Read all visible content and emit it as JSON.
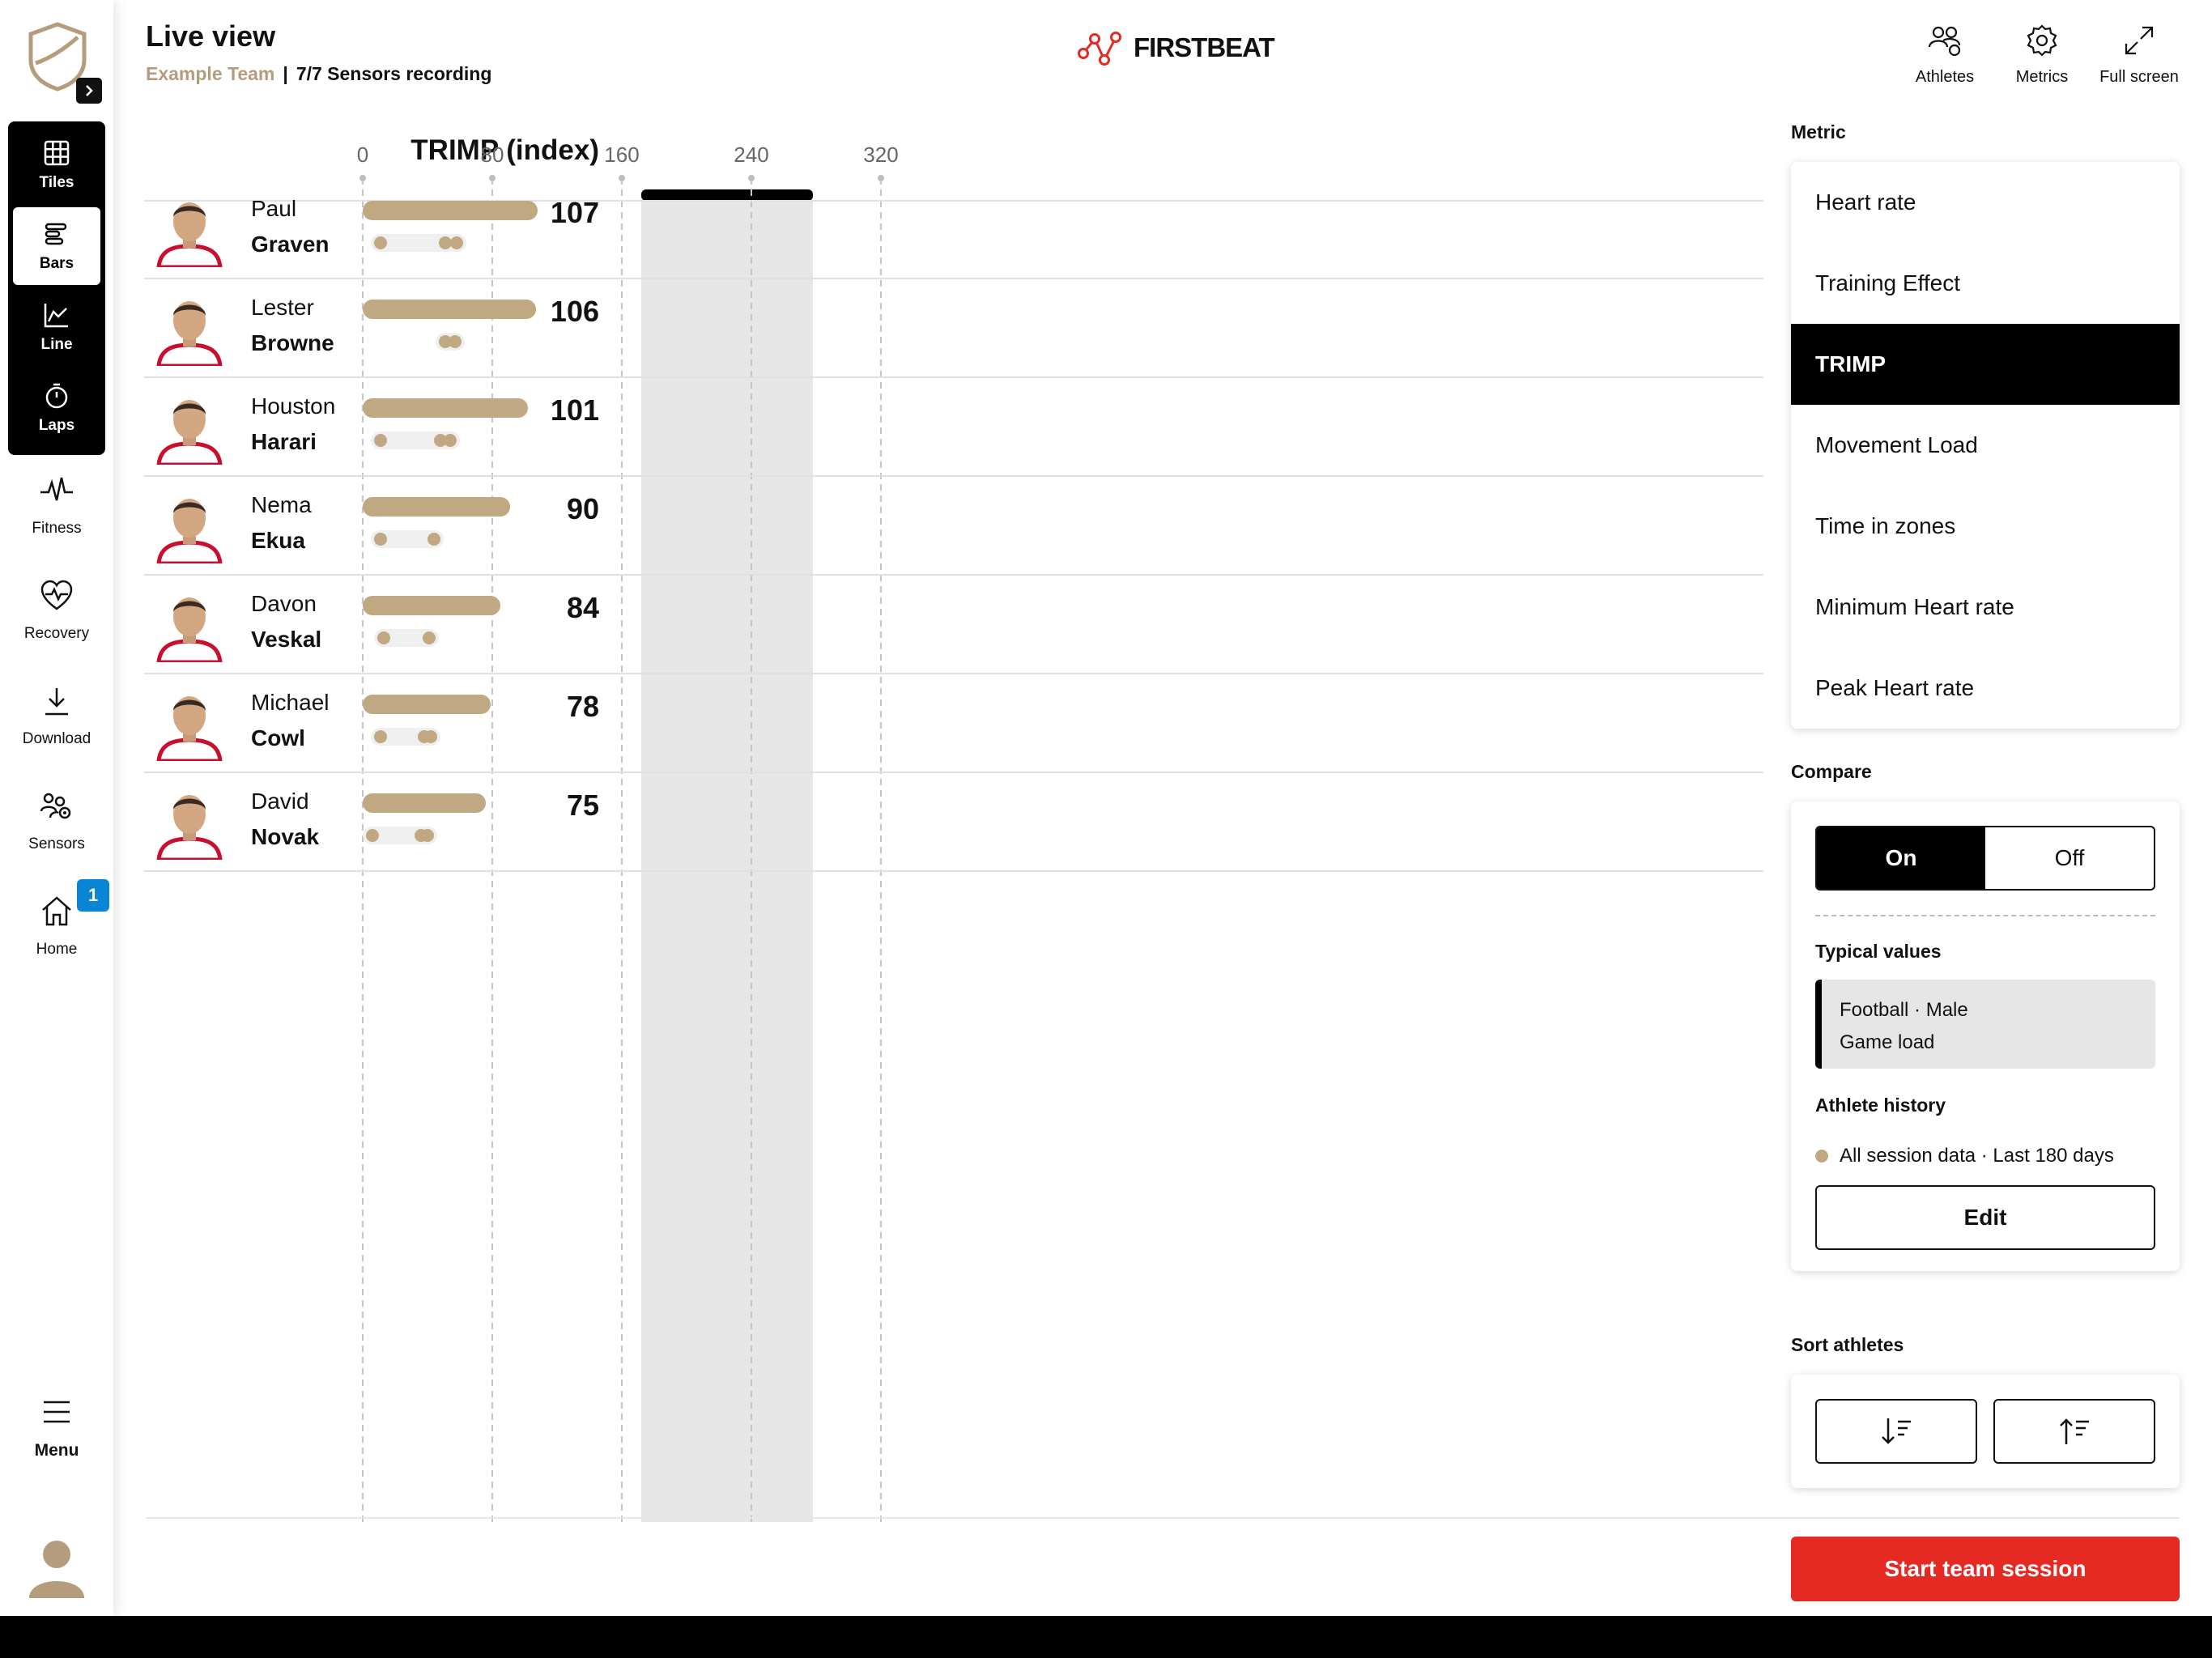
{
  "header": {
    "title": "Live view",
    "team": "Example Team",
    "separator": "|",
    "status": "7/7 Sensors recording",
    "brand": "FIRSTBEAT",
    "actions": [
      {
        "label": "Athletes",
        "icon": "athletes-icon"
      },
      {
        "label": "Metrics",
        "icon": "gear-icon"
      },
      {
        "label": "Full screen",
        "icon": "fullscreen-icon"
      }
    ]
  },
  "nav": {
    "views": [
      {
        "label": "Tiles",
        "icon": "grid-icon"
      },
      {
        "label": "Bars",
        "icon": "bars-icon",
        "active": true
      },
      {
        "label": "Line",
        "icon": "line-chart-icon"
      },
      {
        "label": "Laps",
        "icon": "stopwatch-icon"
      }
    ],
    "items": [
      {
        "label": "Fitness",
        "icon": "heartbeat-icon"
      },
      {
        "label": "Recovery",
        "icon": "heart-pulse-icon"
      },
      {
        "label": "Download",
        "icon": "download-icon"
      },
      {
        "label": "Sensors",
        "icon": "sensors-icon"
      },
      {
        "label": "Home",
        "icon": "home-icon"
      }
    ],
    "home_badge": "1",
    "menu_label": "Menu"
  },
  "chart_data": {
    "type": "bar",
    "title": "TRIMP (index)",
    "x_ticks": [
      "0",
      "80",
      "160",
      "240",
      "320"
    ],
    "xlim": [
      0,
      400
    ],
    "reference_range": [
      172,
      278
    ],
    "colors": {
      "bar": "#c0a882",
      "history_track": "#efefef",
      "reference": "#e6e6e6"
    },
    "athletes": [
      {
        "first": "Paul",
        "last": "Graven",
        "value": 107,
        "history": [
          11,
          51,
          58
        ]
      },
      {
        "first": "Lester",
        "last": "Browne",
        "value": 106,
        "history": [
          51,
          57
        ]
      },
      {
        "first": "Houston",
        "last": "Harari",
        "value": 101,
        "history": [
          11,
          48,
          54
        ]
      },
      {
        "first": "Nema",
        "last": "Ekua",
        "value": 90,
        "history": [
          11,
          44
        ]
      },
      {
        "first": "Davon",
        "last": "Veskal",
        "value": 84,
        "history": [
          13,
          41
        ]
      },
      {
        "first": "Michael",
        "last": "Cowl",
        "value": 78,
        "history": [
          11,
          38,
          42
        ]
      },
      {
        "first": "David",
        "last": "Novak",
        "value": 75,
        "history": [
          6,
          36,
          40
        ]
      }
    ]
  },
  "panel": {
    "metric_title": "Metric",
    "metrics": [
      "Heart rate",
      "Training Effect",
      "TRIMP",
      "Movement Load",
      "Time in zones",
      "Minimum Heart rate",
      "Peak Heart rate"
    ],
    "active_metric": "TRIMP",
    "compare_title": "Compare",
    "toggle_on": "On",
    "toggle_off": "Off",
    "typical_title": "Typical values",
    "typical_line1": "Football · Male",
    "typical_line2": "Game load",
    "history_title": "Athlete history",
    "history_text": "All session data · Last 180 days",
    "edit_label": "Edit",
    "sort_title": "Sort athletes",
    "sort_buttons": [
      {
        "icon": "sort-descending-icon"
      },
      {
        "icon": "sort-ascending-icon"
      }
    ],
    "start_label": "Start team session"
  },
  "colors": {
    "accent": "#e42a22",
    "gold": "#b49c7c",
    "badge": "#0a84d4"
  }
}
